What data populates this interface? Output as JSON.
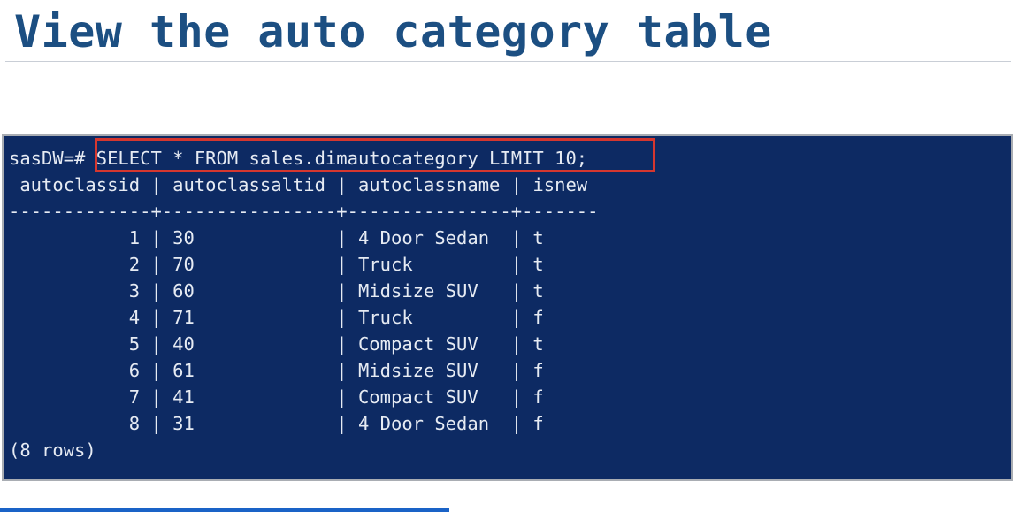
{
  "slide": {
    "title": "View the auto category table"
  },
  "terminal": {
    "prompt": "sasDW=#",
    "command": " SELECT * FROM sales.dimautocategory LIMIT 10;",
    "header": " autoclassid | autoclassaltid | autoclassname | isnew",
    "separator": "-------------+----------------+---------------+-------",
    "columns": [
      "autoclassid",
      "autoclassaltid",
      "autoclassname",
      "isnew"
    ],
    "rows": [
      {
        "autoclassid": "1",
        "autoclassaltid": "30",
        "autoclassname": "4 Door Sedan",
        "isnew": "t",
        "text": "           1 | 30             | 4 Door Sedan  | t"
      },
      {
        "autoclassid": "2",
        "autoclassaltid": "70",
        "autoclassname": "Truck",
        "isnew": "t",
        "text": "           2 | 70             | Truck         | t"
      },
      {
        "autoclassid": "3",
        "autoclassaltid": "60",
        "autoclassname": "Midsize SUV",
        "isnew": "t",
        "text": "           3 | 60             | Midsize SUV   | t"
      },
      {
        "autoclassid": "4",
        "autoclassaltid": "71",
        "autoclassname": "Truck",
        "isnew": "f",
        "text": "           4 | 71             | Truck         | f"
      },
      {
        "autoclassid": "5",
        "autoclassaltid": "40",
        "autoclassname": "Compact SUV",
        "isnew": "t",
        "text": "           5 | 40             | Compact SUV   | t"
      },
      {
        "autoclassid": "6",
        "autoclassaltid": "61",
        "autoclassname": "Midsize SUV",
        "isnew": "f",
        "text": "           6 | 61             | Midsize SUV   | f"
      },
      {
        "autoclassid": "7",
        "autoclassaltid": "41",
        "autoclassname": "Compact SUV",
        "isnew": "f",
        "text": "           7 | 41             | Compact SUV   | f"
      },
      {
        "autoclassid": "8",
        "autoclassaltid": "31",
        "autoclassname": "4 Door Sedan",
        "isnew": "f",
        "text": "           8 | 31             | 4 Door Sedan  | f"
      }
    ],
    "footer": "(8 rows)"
  },
  "colors": {
    "title": "#1c4f82",
    "terminal_bg": "#0d2a63",
    "terminal_text": "#e6ebf3",
    "highlight_border": "#d5372f",
    "progress_bar": "#1a63c7"
  }
}
